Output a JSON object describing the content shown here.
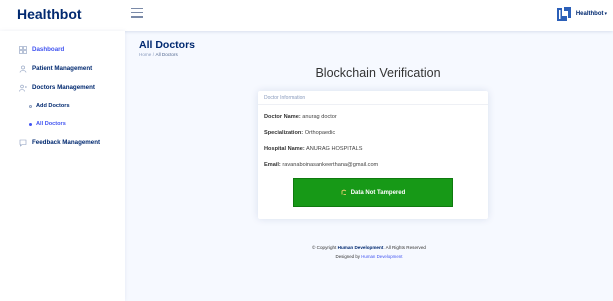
{
  "header": {
    "logo": "Healthbot",
    "user_name": "Healthbot",
    "user_caret": "▾",
    "menu_icon": "hamburger-icon"
  },
  "sidebar": {
    "items": [
      {
        "label": "Dashboard",
        "icon": "grid-icon",
        "active": true
      },
      {
        "label": "Patient Management",
        "icon": "person-icon"
      },
      {
        "label": "Doctors Management",
        "icon": "people-icon"
      },
      {
        "label": "Feedback Management",
        "icon": "chat-icon"
      }
    ],
    "sub_items": [
      {
        "label": "Add Doctors"
      },
      {
        "label": "All Doctors",
        "active": true
      }
    ]
  },
  "main": {
    "title": "All Doctors",
    "breadcrumb": {
      "home": "Home",
      "separator": "/",
      "current": "All Doctors"
    },
    "heading": "Blockchain Verification"
  },
  "card": {
    "header": "Doctor Information",
    "fields": [
      {
        "label": "Doctor Name:",
        "value": "anurag doctor"
      },
      {
        "label": "Specialization:",
        "value": "Orthopaedic"
      },
      {
        "label": "Hospital Name:",
        "value": "ANURAG HOSPITALS"
      },
      {
        "label": "Email:",
        "value": "ravanaboinasankeerthana@gmail.com"
      }
    ],
    "button_label": "Data Not Tampered",
    "button_color": "#179917"
  },
  "footer": {
    "copyright_prefix": "© Copyright",
    "copyright_brand": "Human Development",
    "copyright_suffix": ". All Rights Reserved",
    "designed_prefix": "Designed by",
    "designed_link": "Human Development"
  },
  "colors": {
    "brand": "#012970",
    "accent": "#4154f1",
    "background": "#f6f9ff"
  }
}
